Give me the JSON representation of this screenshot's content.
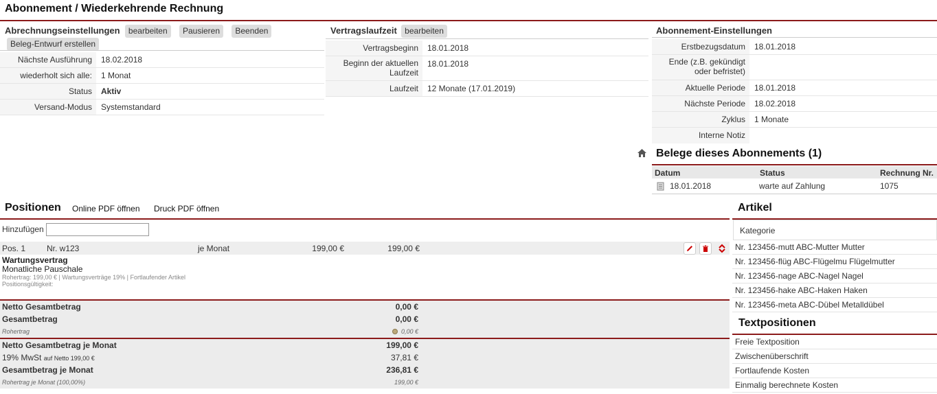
{
  "page": {
    "title": "Abonnement / Wiederkehrende Rechnung"
  },
  "billing": {
    "heading": "Abrechnungseinstellungen",
    "btn_edit": "bearbeiten",
    "btn_pause": "Pausieren",
    "btn_end": "Beenden",
    "btn_draft": "Beleg-Entwurf erstellen",
    "rows": [
      {
        "k": "Nächste Ausführung",
        "v": "18.02.2018"
      },
      {
        "k": "wiederholt sich alle:",
        "v": "1 Monat"
      },
      {
        "k": "Status",
        "v": "Aktiv"
      },
      {
        "k": "Versand-Modus",
        "v": "Systemstandard"
      }
    ]
  },
  "contract": {
    "heading": "Vertragslaufzeit",
    "btn_edit": "bearbeiten",
    "rows": [
      {
        "k": "Vertragsbeginn",
        "v": "18.01.2018"
      },
      {
        "k1": "Beginn der aktuellen",
        "k2": "Laufzeit",
        "v": "18.01.2018"
      },
      {
        "k": "Laufzeit",
        "v": "12 Monate (17.01.2019)"
      }
    ]
  },
  "subscription": {
    "heading": "Abonnement-Einstellungen",
    "rows": [
      {
        "k": "Erstbezugsdatum",
        "v": "18.01.2018"
      },
      {
        "k1": "Ende (z.B. gekündigt",
        "k2": "oder befristet)",
        "v": ""
      },
      {
        "k": "Aktuelle Periode",
        "v": "18.01.2018"
      },
      {
        "k": "Nächste Periode",
        "v": "18.02.2018"
      },
      {
        "k": "Zyklus",
        "v": "1 Monate"
      },
      {
        "k": "Interne Notiz",
        "v": ""
      }
    ]
  },
  "documents": {
    "heading": "Belege dieses Abonnements (1)",
    "col_date": "Datum",
    "col_status": "Status",
    "col_invoice": "Rechnung Nr.",
    "rows": [
      {
        "date": "18.01.2018",
        "status": "warte auf Zahlung",
        "invoice": "1075"
      }
    ]
  },
  "positions": {
    "heading": "Positionen",
    "pdf_online": "Online PDF öffnen",
    "pdf_print": "Druck PDF öffnen",
    "add_label": "Hinzufügen",
    "add_value": "",
    "item": {
      "pos": "Pos. 1",
      "nr": "Nr. w123",
      "period": "je Monat",
      "price": "199,00 €",
      "total": "199,00 €",
      "name": "Wartungsvertrag",
      "desc": "Monatliche Pauschale",
      "meta": "Rohertrag: 199,00 € | Wartungsverträge 19% | Fortlaufender Artikel",
      "validity": "Positionsgültigkeit:"
    }
  },
  "totals": {
    "net_label": "Netto Gesamtbetrag",
    "net_value": "0,00 €",
    "gross_label": "Gesamtbetrag",
    "gross_value": "0,00 €",
    "margin_label": "Rohertrag",
    "margin_value": "0,00 €",
    "net_month_label": "Netto Gesamtbetrag je Monat",
    "net_month_value": "199,00 €",
    "vat_label": "19% MwSt",
    "vat_note": "auf Netto 199,00 €",
    "vat_value": "37,81 €",
    "gross_month_label": "Gesamtbetrag je Monat",
    "gross_month_value": "236,81 €",
    "margin_month_label": "Rohertrag je Monat (100,00%)",
    "margin_month_value": "199,00 €"
  },
  "articles": {
    "heading": "Artikel",
    "category": "Kategorie",
    "items": [
      "Nr. 123456-mutt ABC-Mutter Mutter",
      "Nr. 123456-flüg ABC-Flügelmu Flügelmutter",
      "Nr. 123456-nage ABC-Nagel Nagel",
      "Nr. 123456-hake ABC-Haken Haken",
      "Nr. 123456-meta ABC-Dübel Metalldübel"
    ]
  },
  "textpositions": {
    "heading": "Textpositionen",
    "items": [
      "Freie Textposition",
      "Zwischenüberschrift",
      "Fortlaufende Kosten",
      "Einmalig berechnete Kosten"
    ]
  }
}
